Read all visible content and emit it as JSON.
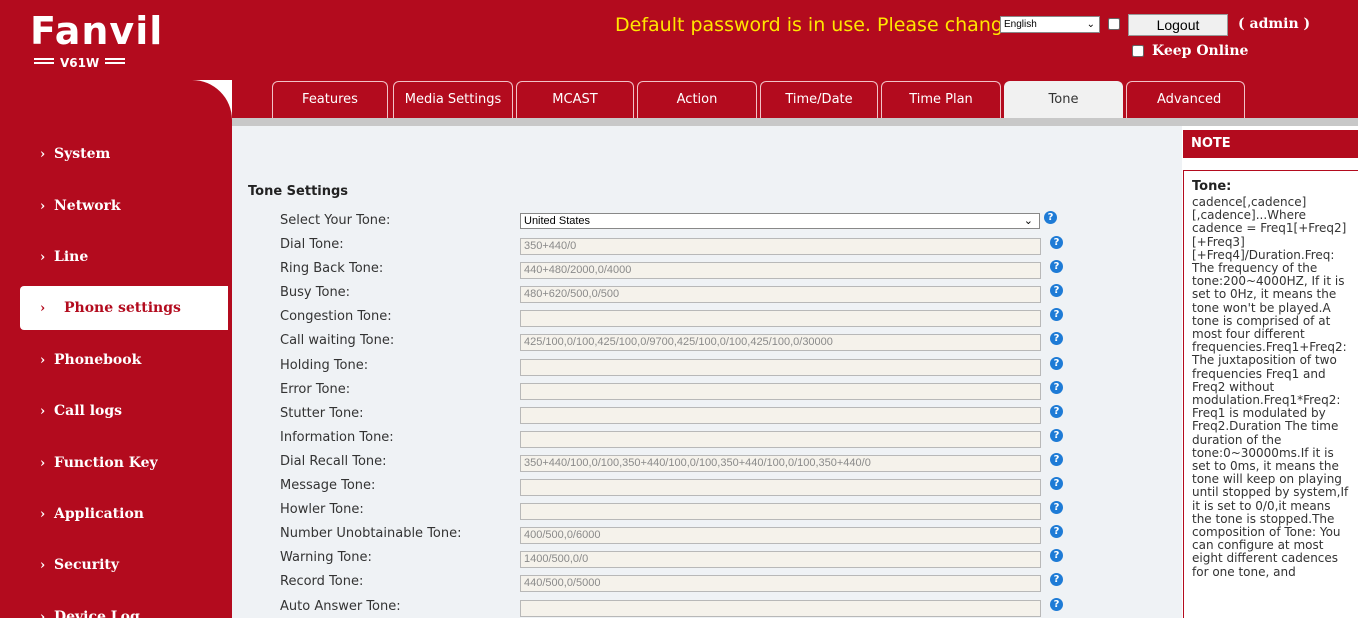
{
  "header": {
    "brand": "Fanvil",
    "model": "V61W",
    "password_warning": "Default password is in use. Please change",
    "language_selected": "English",
    "logout_label": "Logout",
    "user_label": "( admin )",
    "keep_online_label": "Keep Online"
  },
  "sidebar": {
    "items": [
      {
        "label": "System"
      },
      {
        "label": "Network"
      },
      {
        "label": "Line"
      },
      {
        "label": "Phone settings",
        "active": true
      },
      {
        "label": "Phonebook"
      },
      {
        "label": "Call logs"
      },
      {
        "label": "Function Key"
      },
      {
        "label": "Application"
      },
      {
        "label": "Security"
      },
      {
        "label": "Device Log"
      }
    ]
  },
  "tabs": [
    {
      "label": "Features"
    },
    {
      "label": "Media Settings"
    },
    {
      "label": "MCAST"
    },
    {
      "label": "Action"
    },
    {
      "label": "Time/Date"
    },
    {
      "label": "Time Plan"
    },
    {
      "label": "Tone",
      "active": true
    },
    {
      "label": "Advanced"
    }
  ],
  "main": {
    "section_title": "Tone Settings",
    "select_tone_label": "Select Your Tone:",
    "select_tone_value": "United States",
    "rows": [
      {
        "label": "Dial Tone:",
        "value": "350+440/0"
      },
      {
        "label": "Ring Back Tone:",
        "value": "440+480/2000,0/4000"
      },
      {
        "label": "Busy Tone:",
        "value": "480+620/500,0/500"
      },
      {
        "label": "Congestion Tone:",
        "value": ""
      },
      {
        "label": "Call waiting Tone:",
        "value": "425/100,0/100,425/100,0/9700,425/100,0/100,425/100,0/30000"
      },
      {
        "label": "Holding Tone:",
        "value": ""
      },
      {
        "label": "Error Tone:",
        "value": ""
      },
      {
        "label": "Stutter Tone:",
        "value": ""
      },
      {
        "label": "Information Tone:",
        "value": ""
      },
      {
        "label": "Dial Recall Tone:",
        "value": "350+440/100,0/100,350+440/100,0/100,350+440/100,0/100,350+440/0"
      },
      {
        "label": "Message Tone:",
        "value": ""
      },
      {
        "label": "Howler Tone:",
        "value": ""
      },
      {
        "label": "Number Unobtainable Tone:",
        "value": "400/500,0/6000"
      },
      {
        "label": "Warning Tone:",
        "value": "1400/500,0/0"
      },
      {
        "label": "Record Tone:",
        "value": "440/500,0/5000"
      },
      {
        "label": "Auto Answer Tone:",
        "value": ""
      }
    ]
  },
  "note": {
    "header": "NOTE",
    "title": "Tone:",
    "text": "cadence[,cadence][,cadence]...Where cadence = Freq1[+Freq2][+Freq3][+Freq4]/Duration.Freq: The frequency of the tone:200~4000HZ, If it is set to 0Hz, it means the tone won't be played.A tone is comprised of at most four different frequencies.Freq1+Freq2: The juxtaposition of two frequencies Freq1 and Freq2 without modulation.Freq1*Freq2: Freq1 is modulated by Freq2.Duration The time duration of the tone:0~30000ms.If it is set to 0ms, it means the tone will keep on playing until stopped by system,If it is set to 0/0,it means the tone is stopped.The composition of Tone: You can configure at most eight different cadences for one tone, and"
  },
  "colors": {
    "brand_red": "#b30b1e",
    "warning_yellow": "#ffe600",
    "help_blue": "#1e7bd6"
  }
}
